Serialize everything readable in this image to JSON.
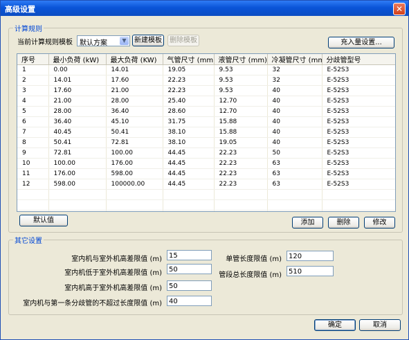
{
  "window": {
    "title": "高级设置",
    "close": "✕"
  },
  "calc_rules": {
    "legend": "计算规则",
    "template_label": "当前计算规则模板",
    "template_value": "默认方案",
    "new_template": "新建模板",
    "delete_template": "删除模板",
    "refrigerant_settings": "充入量设置...",
    "columns": [
      "序号",
      "最小负荷 (kW)",
      "最大负荷 (KW)",
      "气管尺寸 (mm)",
      "液管尺寸 (mm)",
      "冷凝管尺寸 (mm)",
      "分歧管型号"
    ],
    "rows": [
      [
        "1",
        "0.00",
        "14.01",
        "19.05",
        "9.53",
        "32",
        "E-52S3"
      ],
      [
        "2",
        "14.01",
        "17.60",
        "22.23",
        "9.53",
        "32",
        "E-52S3"
      ],
      [
        "3",
        "17.60",
        "21.00",
        "22.23",
        "9.53",
        "40",
        "E-52S3"
      ],
      [
        "4",
        "21.00",
        "28.00",
        "25.40",
        "12.70",
        "40",
        "E-52S3"
      ],
      [
        "5",
        "28.00",
        "36.40",
        "28.60",
        "12.70",
        "40",
        "E-52S3"
      ],
      [
        "6",
        "36.40",
        "45.10",
        "31.75",
        "15.88",
        "40",
        "E-52S3"
      ],
      [
        "7",
        "40.45",
        "50.41",
        "38.10",
        "15.88",
        "40",
        "E-52S3"
      ],
      [
        "8",
        "50.41",
        "72.81",
        "38.10",
        "19.05",
        "40",
        "E-52S3"
      ],
      [
        "9",
        "72.81",
        "100.00",
        "44.45",
        "22.23",
        "50",
        "E-52S3"
      ],
      [
        "10",
        "100.00",
        "176.00",
        "44.45",
        "22.23",
        "63",
        "E-52S3"
      ],
      [
        "11",
        "176.00",
        "598.00",
        "44.45",
        "22.23",
        "63",
        "E-52S3"
      ],
      [
        "12",
        "598.00",
        "100000.00",
        "44.45",
        "22.23",
        "63",
        "E-52S3"
      ]
    ],
    "default_button": "默认值",
    "add_button": "添加",
    "delete_button": "删除",
    "edit_button": "修改"
  },
  "other": {
    "legend": "其它设置",
    "fields": [
      {
        "label": "室内机与室外机高差限值 (m)",
        "value": "15"
      },
      {
        "label": "室内机低于室外机高差限值 (m)",
        "value": "50"
      },
      {
        "label": "室内机高于室外机高差限值 (m)",
        "value": "50"
      },
      {
        "label": "室内机与第一条分歧管的不超过长度限值 (m)",
        "value": "40"
      }
    ],
    "right_fields": [
      {
        "label": "单管长度限值 (m)",
        "value": "120"
      },
      {
        "label": "管段总长度限值 (m)",
        "value": "510"
      }
    ]
  },
  "footer": {
    "ok": "确定",
    "cancel": "取消"
  }
}
